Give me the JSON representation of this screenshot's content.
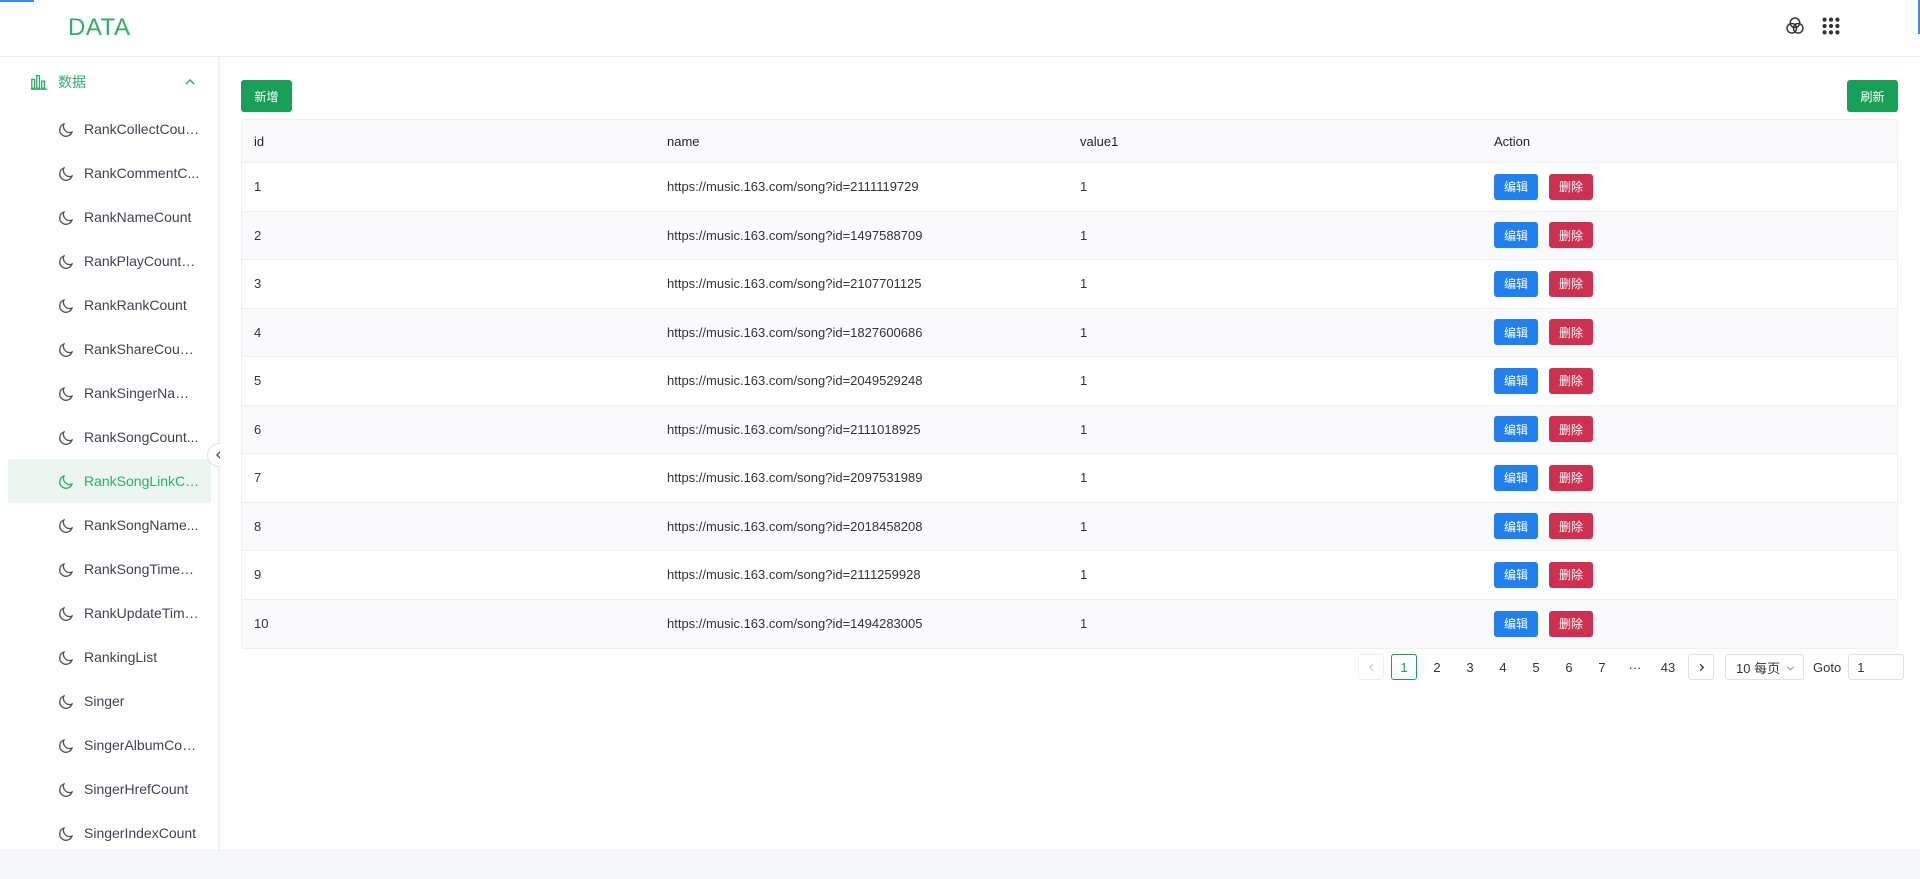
{
  "app": {
    "brand": "DATA"
  },
  "sidebar": {
    "group_label": "数据",
    "items": [
      "RankCollectCoun...",
      "RankCommentC...",
      "RankNameCount",
      "RankPlayCountC...",
      "RankRankCount",
      "RankShareCount...",
      "RankSingerName...",
      "RankSongCount...",
      "RankSongLinkCo...",
      "RankSongName...",
      "RankSongTimeC...",
      "RankUpdateTime...",
      "RankingList",
      "Singer",
      "SingerAlbumCount",
      "SingerHrefCount",
      "SingerIndexCount"
    ],
    "active_index": 8
  },
  "toolbar": {
    "add_label": "新增",
    "refresh_label": "刷新"
  },
  "table": {
    "columns": [
      "id",
      "name",
      "value1",
      "Action"
    ],
    "edit_label": "编辑",
    "delete_label": "删除",
    "rows": [
      [
        "1",
        "https://music.163.com/song?id=2111119729",
        "1"
      ],
      [
        "2",
        "https://music.163.com/song?id=1497588709",
        "1"
      ],
      [
        "3",
        "https://music.163.com/song?id=2107701125",
        "1"
      ],
      [
        "4",
        "https://music.163.com/song?id=1827600686",
        "1"
      ],
      [
        "5",
        "https://music.163.com/song?id=2049529248",
        "1"
      ],
      [
        "6",
        "https://music.163.com/song?id=2111018925",
        "1"
      ],
      [
        "7",
        "https://music.163.com/song?id=2097531989",
        "1"
      ],
      [
        "8",
        "https://music.163.com/song?id=2018458208",
        "1"
      ],
      [
        "9",
        "https://music.163.com/song?id=2111259928",
        "1"
      ],
      [
        "10",
        "https://music.163.com/song?id=1494283005",
        "1"
      ]
    ]
  },
  "pagination": {
    "pages": [
      "1",
      "2",
      "3",
      "4",
      "5",
      "6",
      "7",
      "···",
      "43"
    ],
    "current": "1",
    "page_size": "10 每页",
    "goto_label": "Goto",
    "goto_value": "1"
  },
  "colors": {
    "brand": "#2eae6b",
    "primary": "#18a058",
    "edit": "#2080f0",
    "delete": "#d03050"
  },
  "icons": {
    "group": "bar-chart-icon",
    "item": "moon-icon",
    "collapse": "chevron-up-icon",
    "top_left": "color-filter-icon",
    "top_right": "apps-grid-icon"
  }
}
